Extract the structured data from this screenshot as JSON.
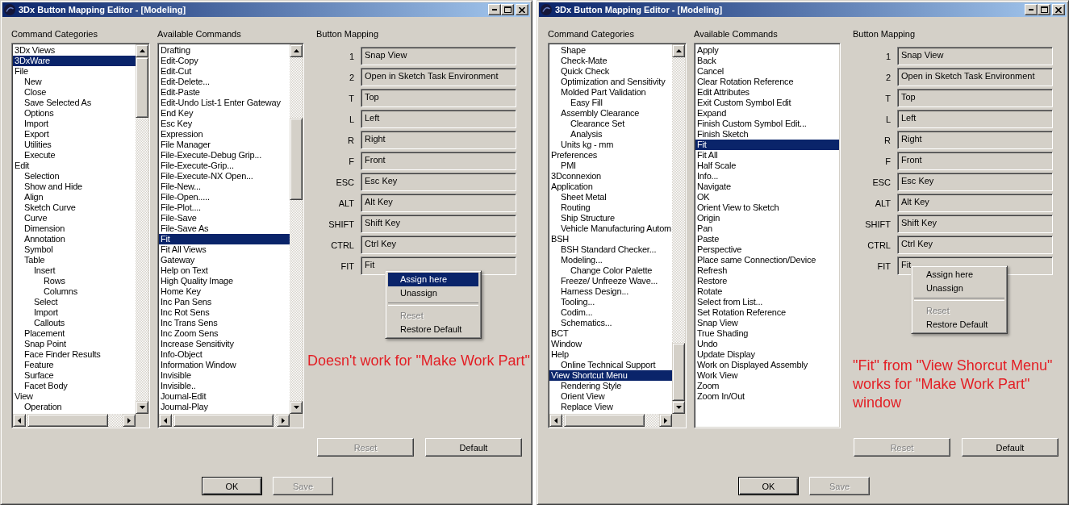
{
  "windows": [
    {
      "title": "3Dx Button Mapping Editor - [Modeling]",
      "categories": {
        "label": "Command Categories",
        "scrollbars": true,
        "items": [
          {
            "label": "3Dx Views",
            "selected": false
          },
          {
            "label": "3DxWare",
            "selected": true
          },
          {
            "label": "File",
            "selected": false,
            "children": [
              {
                "label": "New",
                "selected": false
              },
              {
                "label": "Close",
                "selected": false
              },
              {
                "label": "Save Selected As",
                "selected": false
              },
              {
                "label": "Options",
                "selected": false
              },
              {
                "label": "Import",
                "selected": false
              },
              {
                "label": "Export",
                "selected": false
              },
              {
                "label": "Utilities",
                "selected": false
              },
              {
                "label": "Execute",
                "selected": false
              }
            ]
          },
          {
            "label": "Edit",
            "selected": false,
            "children": [
              {
                "label": "Selection",
                "selected": false
              },
              {
                "label": "Show and Hide",
                "selected": false
              },
              {
                "label": "Align",
                "selected": false
              },
              {
                "label": "Sketch Curve",
                "selected": false
              },
              {
                "label": "Curve",
                "selected": false
              },
              {
                "label": "Dimension",
                "selected": false
              },
              {
                "label": "Annotation",
                "selected": false
              },
              {
                "label": "Symbol",
                "selected": false
              },
              {
                "label": "Table",
                "selected": false,
                "children": [
                  {
                    "label": "Insert",
                    "selected": false,
                    "children": [
                      {
                        "label": "Rows",
                        "selected": false
                      },
                      {
                        "label": "Columns",
                        "selected": false
                      }
                    ]
                  },
                  {
                    "label": "Select",
                    "selected": false
                  },
                  {
                    "label": "Import",
                    "selected": false
                  },
                  {
                    "label": "Callouts",
                    "selected": false
                  }
                ]
              },
              {
                "label": "Placement",
                "selected": false
              },
              {
                "label": "Snap Point",
                "selected": false
              },
              {
                "label": "Face Finder Results",
                "selected": false
              },
              {
                "label": "Feature",
                "selected": false
              },
              {
                "label": "Surface",
                "selected": false
              },
              {
                "label": "Facet Body",
                "selected": false
              }
            ]
          },
          {
            "label": "View",
            "selected": false,
            "children": [
              {
                "label": "Operation",
                "selected": false
              }
            ]
          }
        ]
      },
      "commands": {
        "label": "Available Commands",
        "scrollbars": true,
        "items": [
          {
            "label": "Drafting",
            "selected": false
          },
          {
            "label": "Edit-Copy",
            "selected": false
          },
          {
            "label": "Edit-Cut",
            "selected": false
          },
          {
            "label": "Edit-Delete...",
            "selected": false
          },
          {
            "label": "Edit-Paste",
            "selected": false
          },
          {
            "label": "Edit-Undo List-1 Enter Gateway",
            "selected": false
          },
          {
            "label": "End Key",
            "selected": false
          },
          {
            "label": "Esc Key",
            "selected": false
          },
          {
            "label": "Expression",
            "selected": false
          },
          {
            "label": "File Manager",
            "selected": false
          },
          {
            "label": "File-Execute-Debug Grip...",
            "selected": false
          },
          {
            "label": "File-Execute-Grip...",
            "selected": false
          },
          {
            "label": "File-Execute-NX Open...",
            "selected": false
          },
          {
            "label": "File-New...",
            "selected": false
          },
          {
            "label": "File-Open.....",
            "selected": false
          },
          {
            "label": "File-Plot....",
            "selected": false
          },
          {
            "label": "File-Save",
            "selected": false
          },
          {
            "label": "File-Save As",
            "selected": false
          },
          {
            "label": "Fit",
            "selected": true
          },
          {
            "label": "Fit All Views",
            "selected": false
          },
          {
            "label": "Gateway",
            "selected": false
          },
          {
            "label": "Help on Text",
            "selected": false
          },
          {
            "label": "High Quality Image",
            "selected": false
          },
          {
            "label": "Home Key",
            "selected": false
          },
          {
            "label": "Inc Pan Sens",
            "selected": false
          },
          {
            "label": "Inc Rot Sens",
            "selected": false
          },
          {
            "label": "Inc Trans Sens",
            "selected": false
          },
          {
            "label": "Inc Zoom Sens",
            "selected": false
          },
          {
            "label": "Increase Sensitivity",
            "selected": false
          },
          {
            "label": "Info-Object",
            "selected": false
          },
          {
            "label": "Information Window",
            "selected": false
          },
          {
            "label": "Invisible",
            "selected": false
          },
          {
            "label": "Invisible..",
            "selected": false
          },
          {
            "label": "Journal-Edit",
            "selected": false
          },
          {
            "label": "Journal-Play",
            "selected": false
          }
        ]
      },
      "mapping": {
        "label": "Button Mapping",
        "rows": [
          {
            "key": "1",
            "value": "Snap View"
          },
          {
            "key": "2",
            "value": "Open in Sketch Task Environment"
          },
          {
            "key": "T",
            "value": "Top"
          },
          {
            "key": "L",
            "value": "Left"
          },
          {
            "key": "R",
            "value": "Right"
          },
          {
            "key": "F",
            "value": "Front"
          },
          {
            "key": "ESC",
            "value": "Esc Key"
          },
          {
            "key": "ALT",
            "value": "Alt Key"
          },
          {
            "key": "SHIFT",
            "value": "Shift Key"
          },
          {
            "key": "CTRL",
            "value": "Ctrl Key"
          },
          {
            "key": "FIT",
            "value": "Fit"
          }
        ]
      },
      "context_menu": {
        "items": [
          {
            "kind": "item",
            "label": "Assign here",
            "selected": true,
            "disabled": false
          },
          {
            "kind": "item",
            "label": "Unassign",
            "selected": false,
            "disabled": false
          },
          {
            "kind": "separator"
          },
          {
            "kind": "item",
            "label": "Reset",
            "selected": false,
            "disabled": true
          },
          {
            "kind": "item",
            "label": "Restore Default",
            "selected": false,
            "disabled": false
          }
        ]
      },
      "note": "Doesn't work for \"Make Work Part\"",
      "buttons": [
        {
          "label": "Reset",
          "disabled": true
        },
        {
          "label": "Default",
          "disabled": false
        }
      ],
      "footer_buttons": [
        {
          "label": "OK",
          "disabled": false,
          "default": true
        },
        {
          "label": "Save",
          "disabled": true,
          "default": false
        }
      ]
    },
    {
      "title": "3Dx Button Mapping Editor - [Modeling]",
      "categories": {
        "label": "Command Categories",
        "scrollbars": true,
        "items": [
          {
            "children": [
              {
                "label": "Shape",
                "selected": false
              },
              {
                "label": "Check-Mate",
                "selected": false
              },
              {
                "label": "Quick Check",
                "selected": false
              },
              {
                "label": "Optimization and Sensitivity",
                "selected": false
              },
              {
                "label": "Molded Part Validation",
                "selected": false,
                "children": [
                  {
                    "label": "Easy Fill",
                    "selected": false
                  }
                ]
              },
              {
                "label": "Assembly Clearance",
                "selected": false,
                "children": [
                  {
                    "label": "Clearance Set",
                    "selected": false
                  },
                  {
                    "label": "Analysis",
                    "selected": false
                  }
                ]
              },
              {
                "label": "Units kg - mm",
                "selected": false
              }
            ]
          },
          {
            "label": "Preferences",
            "selected": false,
            "children": [
              {
                "label": "PMI",
                "selected": false
              }
            ]
          },
          {
            "label": "3Dconnexion",
            "selected": false
          },
          {
            "label": "Application",
            "selected": false,
            "children": [
              {
                "label": "Sheet Metal",
                "selected": false
              },
              {
                "label": "Routing",
                "selected": false
              },
              {
                "label": "Ship Structure",
                "selected": false
              },
              {
                "label": "Vehicle Manufacturing Autom",
                "selected": false
              }
            ]
          },
          {
            "label": "BSH",
            "selected": false,
            "children": [
              {
                "label": "BSH Standard Checker...",
                "selected": false
              },
              {
                "label": "Modeling...",
                "selected": false,
                "children": [
                  {
                    "label": "Change Color Palette",
                    "selected": false
                  }
                ]
              },
              {
                "label": "Freeze/ Unfreeze Wave...",
                "selected": false
              },
              {
                "label": "Harness Design...",
                "selected": false
              },
              {
                "label": "Tooling...",
                "selected": false
              },
              {
                "label": "Codim...",
                "selected": false
              },
              {
                "label": "Schematics...",
                "selected": false
              }
            ]
          },
          {
            "label": "BCT",
            "selected": false
          },
          {
            "label": "Window",
            "selected": false
          },
          {
            "label": "Help",
            "selected": false,
            "children": [
              {
                "label": "Online Technical Support",
                "selected": false
              }
            ]
          },
          {
            "label": "View Shortcut Menu",
            "selected": true,
            "children": [
              {
                "label": "Rendering Style",
                "selected": false
              },
              {
                "label": "Orient View",
                "selected": false
              },
              {
                "label": "Replace View",
                "selected": false
              }
            ]
          }
        ]
      },
      "commands": {
        "label": "Available Commands",
        "scrollbars": false,
        "items": [
          {
            "label": "Apply",
            "selected": false
          },
          {
            "label": "Back",
            "selected": false
          },
          {
            "label": "Cancel",
            "selected": false
          },
          {
            "label": "Clear Rotation Reference",
            "selected": false
          },
          {
            "label": "Edit Attributes",
            "selected": false
          },
          {
            "label": "Exit Custom Symbol Edit",
            "selected": false
          },
          {
            "label": "Expand",
            "selected": false
          },
          {
            "label": "Finish Custom Symbol Edit...",
            "selected": false
          },
          {
            "label": "Finish Sketch",
            "selected": false
          },
          {
            "label": "Fit",
            "selected": true
          },
          {
            "label": "Fit All",
            "selected": false
          },
          {
            "label": "Half Scale",
            "selected": false
          },
          {
            "label": "Info...",
            "selected": false
          },
          {
            "label": "Navigate",
            "selected": false
          },
          {
            "label": "OK",
            "selected": false
          },
          {
            "label": "Orient View to Sketch",
            "selected": false
          },
          {
            "label": "Origin",
            "selected": false
          },
          {
            "label": "Pan",
            "selected": false
          },
          {
            "label": "Paste",
            "selected": false
          },
          {
            "label": "Perspective",
            "selected": false
          },
          {
            "label": "Place same Connection/Device",
            "selected": false
          },
          {
            "label": "Refresh",
            "selected": false
          },
          {
            "label": "Restore",
            "selected": false
          },
          {
            "label": "Rotate",
            "selected": false
          },
          {
            "label": "Select from List...",
            "selected": false
          },
          {
            "label": "Set Rotation Reference",
            "selected": false
          },
          {
            "label": "Snap View",
            "selected": false
          },
          {
            "label": "True Shading",
            "selected": false
          },
          {
            "label": "Undo",
            "selected": false
          },
          {
            "label": "Update Display",
            "selected": false
          },
          {
            "label": "Work on Displayed Assembly",
            "selected": false
          },
          {
            "label": "Work View",
            "selected": false
          },
          {
            "label": "Zoom",
            "selected": false
          },
          {
            "label": "Zoom In/Out",
            "selected": false
          }
        ]
      },
      "mapping": {
        "label": "Button Mapping",
        "rows": [
          {
            "key": "1",
            "value": "Snap View"
          },
          {
            "key": "2",
            "value": "Open in Sketch Task Environment"
          },
          {
            "key": "T",
            "value": "Top"
          },
          {
            "key": "L",
            "value": "Left"
          },
          {
            "key": "R",
            "value": "Right"
          },
          {
            "key": "F",
            "value": "Front"
          },
          {
            "key": "ESC",
            "value": "Esc Key"
          },
          {
            "key": "ALT",
            "value": "Alt Key"
          },
          {
            "key": "SHIFT",
            "value": "Shift Key"
          },
          {
            "key": "CTRL",
            "value": "Ctrl Key"
          },
          {
            "key": "FIT",
            "value": "Fit"
          }
        ]
      },
      "context_menu": {
        "items": [
          {
            "kind": "item",
            "label": "Assign here",
            "selected": false,
            "disabled": false
          },
          {
            "kind": "item",
            "label": "Unassign",
            "selected": false,
            "disabled": false
          },
          {
            "kind": "separator"
          },
          {
            "kind": "item",
            "label": "Reset",
            "selected": false,
            "disabled": true
          },
          {
            "kind": "item",
            "label": "Restore Default",
            "selected": false,
            "disabled": false
          }
        ]
      },
      "note": "\"Fit\" from \"View Shorcut Menu\" works for \"Make Work Part\" window",
      "buttons": [
        {
          "label": "Reset",
          "disabled": true
        },
        {
          "label": "Default",
          "disabled": false
        }
      ],
      "footer_buttons": [
        {
          "label": "OK",
          "disabled": false,
          "default": true
        },
        {
          "label": "Save",
          "disabled": true,
          "default": false
        }
      ]
    }
  ]
}
